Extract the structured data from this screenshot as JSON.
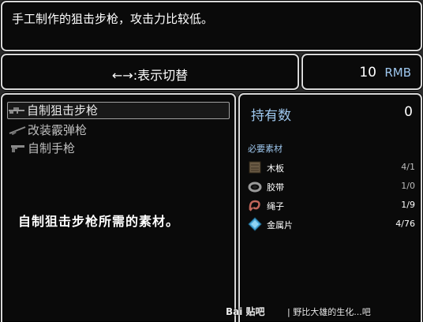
{
  "description": "手工制作的狙击步枪，攻击力比较低。",
  "switch_hint": "←→:表示切替",
  "money": {
    "amount": "10",
    "unit": "RMB"
  },
  "items": [
    {
      "label": "自制狙击步枪",
      "icon": "sniper-rifle-icon",
      "selected": true
    },
    {
      "label": "改装霰弹枪",
      "icon": "shotgun-icon",
      "selected": false
    },
    {
      "label": "自制手枪",
      "icon": "pistol-icon",
      "selected": false
    }
  ],
  "info": "自制狙击步枪所需的素材。",
  "possess": {
    "label": "持有数",
    "value": "0"
  },
  "required_label": "必要素材",
  "materials": [
    {
      "name": "木板",
      "count": "4/1",
      "icon": "wood-plank-icon"
    },
    {
      "name": "胶带",
      "count": "1/0",
      "icon": "tape-icon"
    },
    {
      "name": "绳子",
      "count": "1/9",
      "icon": "rope-icon"
    },
    {
      "name": "金属片",
      "count": "4/76",
      "icon": "metal-piece-icon"
    }
  ],
  "watermark": {
    "logo": "Bai 贴吧",
    "text": "| 野比大雄的生化...吧"
  },
  "colors": {
    "accent": "#9ec7ee",
    "border": "#d8d8d8",
    "panel": "#080808"
  }
}
